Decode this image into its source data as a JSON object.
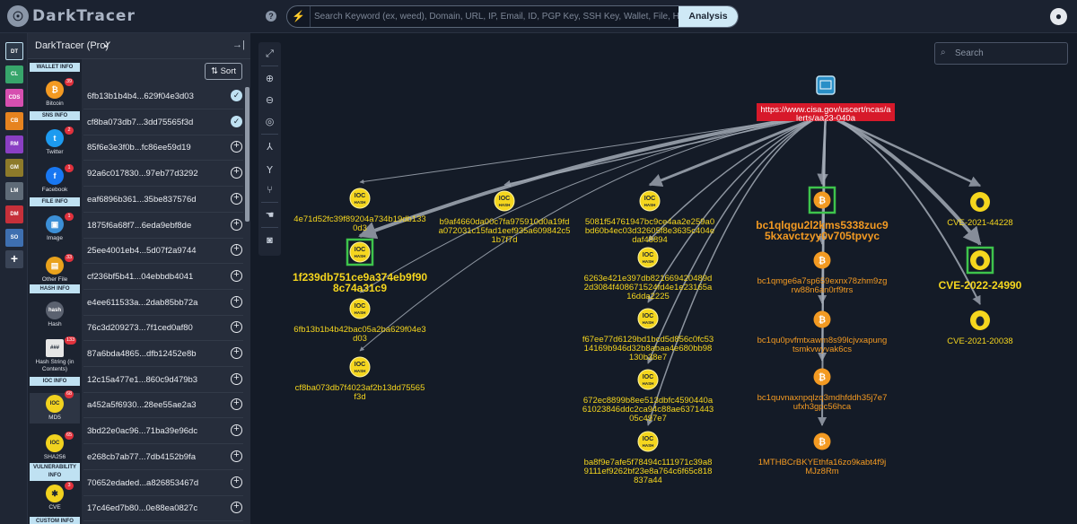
{
  "app": {
    "logo_text": "DarkTracer",
    "help": "?",
    "user_icon": "user-icon"
  },
  "search": {
    "placeholder": "Search Keyword (ex, weed), Domain, URL, IP, Email, ID, PGP Key, SSH Key, Wallet, File, Hash, etc...",
    "button": "Analysis"
  },
  "rail": [
    {
      "label": "DT",
      "color": "#2d3a4a"
    },
    {
      "label": "CL",
      "color": "#37a56b"
    },
    {
      "label": "CDS",
      "color": "#d64fb0"
    },
    {
      "label": "CB",
      "color": "#e6831f"
    },
    {
      "label": "RM",
      "color": "#8a3fc4"
    },
    {
      "label": "GM",
      "color": "#8d7a2a"
    },
    {
      "label": "LM",
      "color": "#5f6b78"
    },
    {
      "label": "DM",
      "color": "#c6303a"
    },
    {
      "label": "SO",
      "color": "#3e6fb0"
    },
    {
      "label": "+",
      "color": "#3a4456"
    }
  ],
  "panel": {
    "title": "DarkTracer (Pro)",
    "sort": "Sort"
  },
  "sections": {
    "wallet": "WALLET INFO",
    "sns": "SNS INFO",
    "file": "FILE INFO",
    "hash": "HASH INFO",
    "ioc": "IOC INFO",
    "vuln": "VULNERABILITY INFO",
    "custom": "CUSTOM INFO"
  },
  "categories": [
    {
      "label": "Bitcoin",
      "badge": "39",
      "icon": "₿",
      "color": "#f39a22"
    },
    {
      "label": "Twitter",
      "badge": "2",
      "icon": "t",
      "color": "#1d9bf0"
    },
    {
      "label": "Facebook",
      "badge": "1",
      "icon": "f",
      "color": "#1877f2"
    },
    {
      "label": "Image",
      "badge": "1",
      "icon": "▣",
      "color": "#3c8fd6"
    },
    {
      "label": "Other File",
      "badge": "33",
      "icon": "▤",
      "color": "#e9a21c"
    },
    {
      "label": "Hash",
      "badge": "",
      "icon": "hash",
      "color": "#5b6270"
    },
    {
      "label": "Hash String (in Contents)",
      "badge": "133",
      "icon": "###",
      "color": "#e6e6e6"
    },
    {
      "label": "MD5",
      "badge": "68",
      "icon": "IOC",
      "color": "#f1d21f"
    },
    {
      "label": "SHA256",
      "badge": "65",
      "icon": "IOC",
      "color": "#f1d21f"
    },
    {
      "label": "CVE",
      "badge": "3",
      "icon": "✱",
      "color": "#f1d21f"
    }
  ],
  "list": [
    {
      "hash": "6fb13b1b4b4...629f04e3d03",
      "checked": true
    },
    {
      "hash": "cf8ba073db7...3dd75565f3d",
      "checked": true
    },
    {
      "hash": "85f6e3e3f0b...fc86ee59d19",
      "checked": false
    },
    {
      "hash": "92a6c017830...97eb77d3292",
      "checked": false
    },
    {
      "hash": "eaf6896b361...35be837576d",
      "checked": false
    },
    {
      "hash": "1875f6a68f7...6eda9ebf8de",
      "checked": false
    },
    {
      "hash": "25ee4001eb4...5d07f2a9744",
      "checked": false
    },
    {
      "hash": "cf236bf5b41...04ebbdb4041",
      "checked": false
    },
    {
      "hash": "e4ee611533a...2dab85bb72a",
      "checked": false
    },
    {
      "hash": "76c3d209273...7f1ced0af80",
      "checked": false
    },
    {
      "hash": "87a6bda4865...dfb12452e8b",
      "checked": false
    },
    {
      "hash": "12c15a477e1...860c9d479b3",
      "checked": false
    },
    {
      "hash": "a452a5f6930...28ee55ae2a3",
      "checked": false
    },
    {
      "hash": "3bd22e0ac96...71ba39e96dc",
      "checked": false
    },
    {
      "hash": "e268cb7ab77...7db4152b9fa",
      "checked": false
    },
    {
      "hash": "70652edaded...a826853467d",
      "checked": false
    },
    {
      "hash": "17c46ed7b80...0e88ea0827c",
      "checked": false
    }
  ],
  "tools": [
    "fit-icon",
    "zoom-in-icon",
    "zoom-out-icon",
    "center-icon",
    "tree-down-icon",
    "tree-up-icon",
    "branch-icon",
    "select-icon",
    "camera-icon"
  ],
  "graph_search": {
    "placeholder": "Search"
  },
  "graph": {
    "root": {
      "label": "https://www.cisa.gov/uscert/ncas/alerts/aa23-040a",
      "lines": [
        "https://www.cisa.gov/uscert/ncas/a",
        "lerts/aa23-040a"
      ]
    },
    "nodes": [
      {
        "id": "n1",
        "type": "ioc",
        "lines": [
          "4e71d52fc39f89204a734b19db133",
          "0d3"
        ]
      },
      {
        "id": "n2",
        "type": "ioc",
        "lines": [
          "b9af4660da00c7fa975910d0a19fd",
          "a072031c15fad1eef935a609842c5",
          "1b7f7d"
        ]
      },
      {
        "id": "n3",
        "type": "ioc",
        "lines": [
          "5081f54761947bc9ce4aa2e259a0",
          "bd60b4ec03d32605f8e3635c404e",
          "daf48894"
        ]
      },
      {
        "id": "n4",
        "type": "ioc",
        "lines": [
          "1f239db751ce9a374eb9f90",
          "8c74a31c9"
        ],
        "highlight": true
      },
      {
        "id": "n5",
        "type": "ioc",
        "lines": [
          "6fb13b1b4b42bac05a2ba629f04e3",
          "d03"
        ]
      },
      {
        "id": "n6",
        "type": "ioc",
        "lines": [
          "cf8ba073db7f4023af2b13dd75565",
          "f3d"
        ]
      },
      {
        "id": "n7",
        "type": "ioc",
        "lines": [
          "6263e421e397db821669420489d",
          "2d3084f408671524fd4e1e23165a",
          "16dda2225"
        ]
      },
      {
        "id": "n8",
        "type": "ioc",
        "lines": [
          "f67ee77d6129bd1bcd5d856c0fc53",
          "14169b946d32b8abaa4e680bb98",
          "130b38e7"
        ]
      },
      {
        "id": "n9",
        "type": "ioc",
        "lines": [
          "672ec8899b8ee513dbfc4590440a",
          "61023846ddc2ca94c88ae6371443",
          "05c497e7"
        ]
      },
      {
        "id": "n10",
        "type": "ioc",
        "lines": [
          "ba8f9e7afe5f78494c111971c39a8",
          "9111ef9262bf23e8a764c6f65c818",
          "837a44"
        ]
      },
      {
        "id": "b1",
        "type": "btc",
        "lines": [
          "bc1qlqgu2l2kms5338zuc9",
          "5kxavctzyy0v705tpvyc"
        ],
        "highlight": true
      },
      {
        "id": "b2",
        "type": "btc",
        "lines": [
          "bc1qmge6a7sp659exnx78zhm9zg",
          "rw88n6an0rf9trs"
        ]
      },
      {
        "id": "b3",
        "type": "btc",
        "lines": [
          "bc1qu0pvfmtxawm8s99lcjvxapung",
          "tsmkvwyvak6cs"
        ]
      },
      {
        "id": "b4",
        "type": "btc",
        "lines": [
          "bc1quvnaxnpqlzq3mdhfddh35j7e7",
          "ufxh3gpc56hca"
        ]
      },
      {
        "id": "b5",
        "type": "btc",
        "lines": [
          "1MTHBCrBKYEthfa16zo9kabt4f9j",
          "MJz8Rm"
        ]
      },
      {
        "id": "c1",
        "type": "cve",
        "lines": [
          "CVE-2021-44228"
        ]
      },
      {
        "id": "c2",
        "type": "cve",
        "lines": [
          "CVE-2022-24990"
        ],
        "highlight": true
      },
      {
        "id": "c3",
        "type": "cve",
        "lines": [
          "CVE-2021-20038"
        ]
      }
    ],
    "node_icon_text": "IOC",
    "node_icon_sub": "HASH"
  }
}
